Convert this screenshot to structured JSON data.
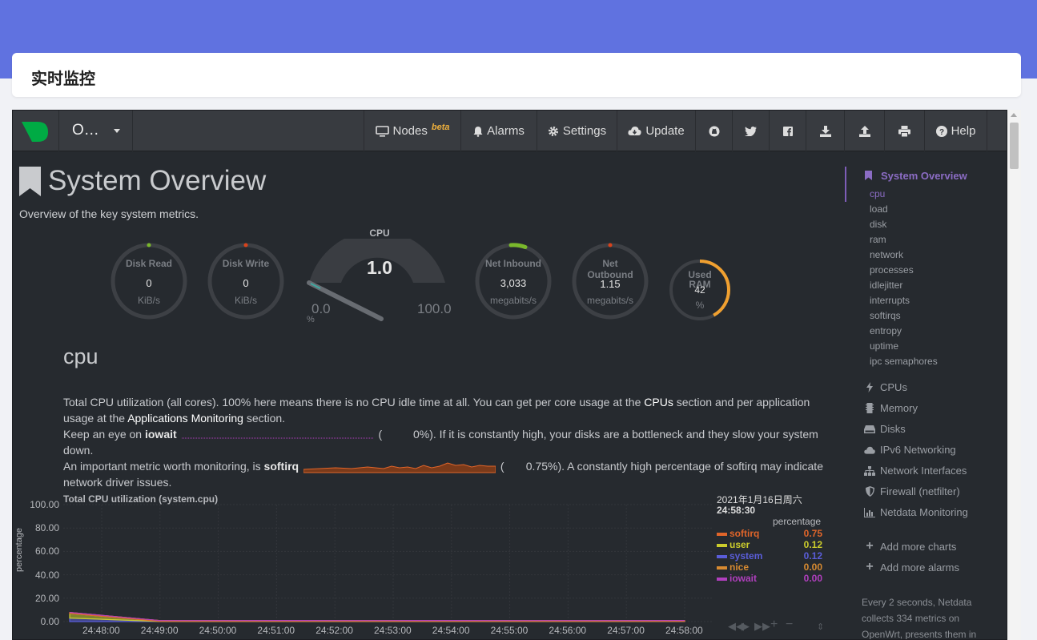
{
  "page": {
    "title": "实时监控"
  },
  "navbar": {
    "host": "O…",
    "buttons": {
      "nodes": "Nodes",
      "nodes_badge": "beta",
      "alarms": "Alarms",
      "settings": "Settings",
      "update": "Update",
      "help": "Help"
    }
  },
  "overview": {
    "title": "System Overview",
    "subtitle": "Overview of the key system metrics."
  },
  "gauges": {
    "disk_read": {
      "label": "Disk Read",
      "value": "0",
      "unit": "KiB/s"
    },
    "disk_write": {
      "label": "Disk Write",
      "value": "0",
      "unit": "KiB/s"
    },
    "cpu": {
      "label": "CPU",
      "value": "1.0",
      "min": "0.0",
      "max": "100.0",
      "unit": "%",
      "level": 1.0
    },
    "net_inbound": {
      "label": "Net Inbound",
      "value": "3,033",
      "unit": "megabits/s"
    },
    "net_outbound": {
      "label": "Net Outbound",
      "value": "1.15",
      "unit": "megabits/s"
    },
    "used_ram": {
      "label": "Used RAM",
      "value": "42",
      "unit": "%",
      "level": 42
    }
  },
  "cpu_section": {
    "heading": "cpu",
    "p1_a": "Total CPU utilization (all cores). 100% here means there is no CPU idle time at all. You can get per core usage at the ",
    "p1_link1": "CPUs",
    "p1_b": " section and per application usage at the ",
    "p1_link2": "Applications Monitoring",
    "p1_c": " section.",
    "p2_a": "Keep an eye on ",
    "p2_b": "iowait",
    "p2_c": "0%). If it is constantly high, your disks are a bottleneck and they slow your system down.",
    "p3_a": "An important metric worth monitoring, is ",
    "p3_b": "softirq",
    "p3_c": "0.75%). A constantly high percentage of softirq may indicate network driver issues."
  },
  "chart_data": {
    "type": "area",
    "title": "Total CPU utilization (system.cpu)",
    "ylabel": "percentage",
    "xlabel": "",
    "ylim": [
      0,
      100
    ],
    "yticks": [
      "100.00",
      "80.00",
      "60.00",
      "40.00",
      "20.00",
      "0.00"
    ],
    "x": [
      "24:48:00",
      "24:49:00",
      "24:50:00",
      "24:51:00",
      "24:52:00",
      "24:53:00",
      "24:54:00",
      "24:55:00",
      "24:56:00",
      "24:57:00",
      "24:58:00"
    ],
    "series": [
      {
        "name": "softirq",
        "color": "#e0652a",
        "values": [
          0.8,
          0.7,
          0.7,
          0.8,
          0.7,
          0.7,
          0.8,
          0.7,
          0.7,
          0.7,
          0.75
        ]
      },
      {
        "name": "user",
        "color": "#cbcc2c",
        "values": [
          4.0,
          0.1,
          0.1,
          0.1,
          0.1,
          0.1,
          0.1,
          0.1,
          0.1,
          0.1,
          0.12
        ]
      },
      {
        "name": "system",
        "color": "#5a5dd8",
        "values": [
          3.0,
          0.1,
          0.1,
          0.1,
          0.1,
          0.1,
          0.1,
          0.1,
          0.1,
          0.1,
          0.12
        ]
      },
      {
        "name": "nice",
        "color": "#d78a31",
        "values": [
          0,
          0,
          0,
          0,
          0,
          0,
          0,
          0,
          0,
          0,
          0
        ]
      },
      {
        "name": "iowait",
        "color": "#b03fbd",
        "values": [
          0,
          0,
          0,
          0,
          0,
          0,
          0,
          0,
          0,
          0,
          0
        ]
      }
    ]
  },
  "legend": {
    "date": "2021年1月16日周六",
    "time": "24:58:30",
    "unit": "percentage",
    "rows": [
      {
        "name": "softirq",
        "value": "0.75"
      },
      {
        "name": "user",
        "value": "0.12"
      },
      {
        "name": "system",
        "value": "0.12"
      },
      {
        "name": "nice",
        "value": "0.00"
      },
      {
        "name": "iowait",
        "value": "0.00"
      }
    ]
  },
  "sidebar": {
    "active": "System Overview",
    "sub": [
      "cpu",
      "load",
      "disk",
      "ram",
      "network",
      "processes",
      "idlejitter",
      "interrupts",
      "softirqs",
      "entropy",
      "uptime",
      "ipc semaphores"
    ],
    "sections": [
      "CPUs",
      "Memory",
      "Disks",
      "IPv6 Networking",
      "Network Interfaces",
      "Firewall (netfilter)",
      "Netdata Monitoring"
    ],
    "add_charts": "Add more charts",
    "add_alarms": "Add more alarms",
    "info": "Every 2 seconds, Netdata collects 334 metrics on OpenWrt, presents them in"
  },
  "colors": {
    "brand": "#6072e0",
    "logo": "#00ab44",
    "accent": "#8b6cc4",
    "ram_gauge": "#f0a030"
  }
}
